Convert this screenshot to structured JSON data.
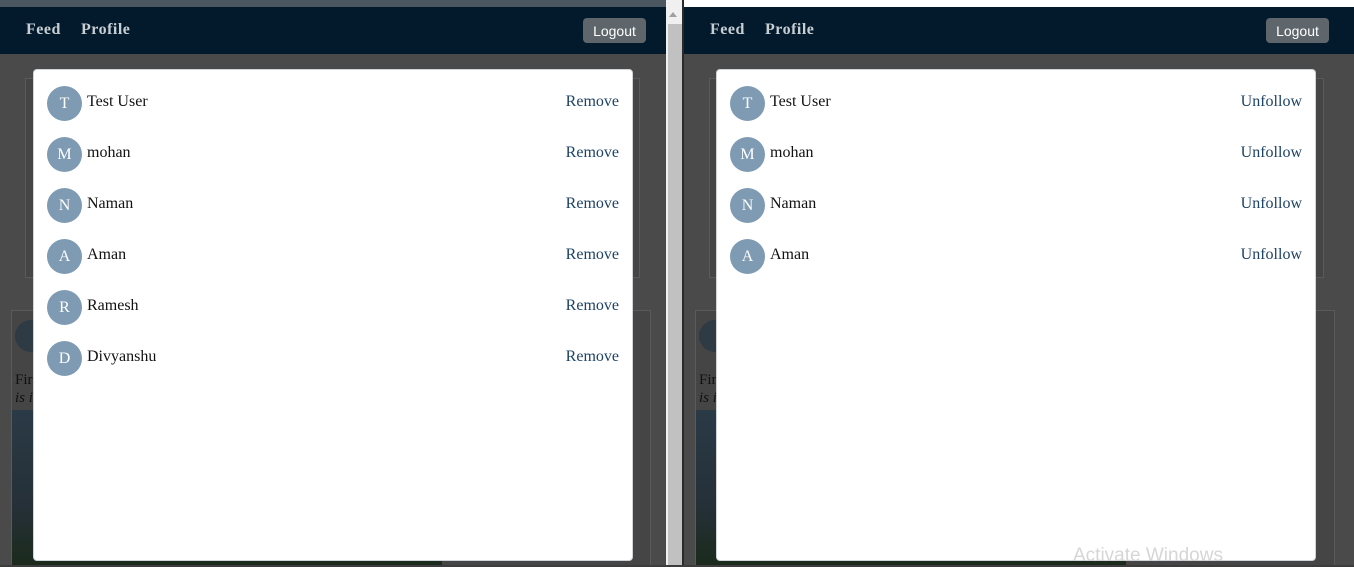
{
  "left_window": {
    "nav": {
      "feed": "Feed",
      "profile": "Profile",
      "logout": "Logout"
    },
    "background": {
      "text_line1": "Fir",
      "text_line2": "is i"
    },
    "modal": {
      "users": [
        {
          "initial": "T",
          "name": "Test User",
          "action": "Remove"
        },
        {
          "initial": "M",
          "name": "mohan",
          "action": "Remove"
        },
        {
          "initial": "N",
          "name": "Naman",
          "action": "Remove"
        },
        {
          "initial": "A",
          "name": "Aman",
          "action": "Remove"
        },
        {
          "initial": "R",
          "name": "Ramesh",
          "action": "Remove"
        },
        {
          "initial": "D",
          "name": "Divyanshu",
          "action": "Remove"
        }
      ]
    }
  },
  "right_window": {
    "nav": {
      "feed": "Feed",
      "profile": "Profile",
      "logout": "Logout"
    },
    "background": {
      "text_line1": "Fir",
      "text_line2": "is i"
    },
    "modal": {
      "users": [
        {
          "initial": "T",
          "name": "Test User",
          "action": "Unfollow"
        },
        {
          "initial": "M",
          "name": "mohan",
          "action": "Unfollow"
        },
        {
          "initial": "N",
          "name": "Naman",
          "action": "Unfollow"
        },
        {
          "initial": "A",
          "name": "Aman",
          "action": "Unfollow"
        }
      ]
    }
  },
  "os_watermark": "Activate Windows",
  "colors": {
    "navbar": "#021a2b",
    "avatar": "#7f9bb3",
    "link": "#1d4266",
    "logout_button": "#5e666c"
  }
}
